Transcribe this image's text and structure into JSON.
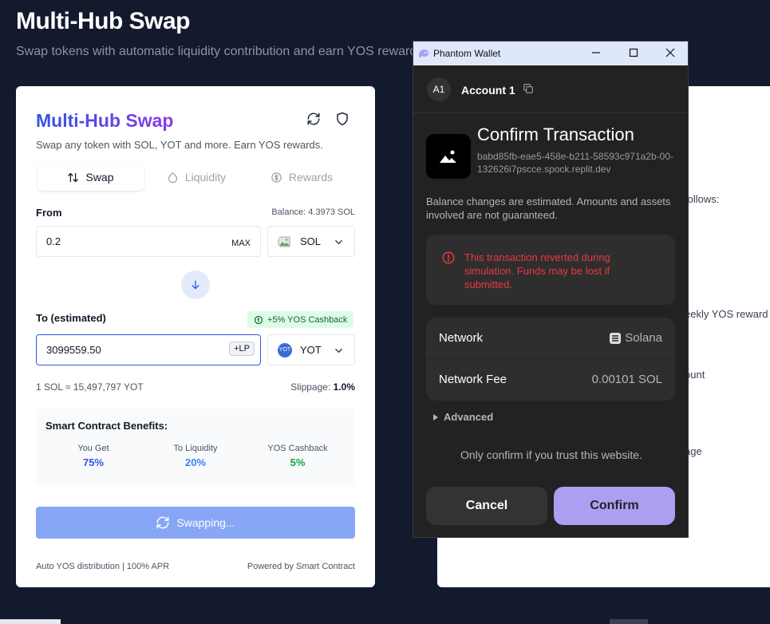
{
  "page": {
    "title": "Multi-Hub Swap",
    "subtitle": "Swap tokens with automatic liquidity contribution and earn YOS rewards"
  },
  "card": {
    "title": "Multi-Hub Swap",
    "description": "Swap any token with SOL, YOT and more. Earn YOS rewards.",
    "tabs": [
      {
        "label": "Swap",
        "icon": "swap-arrows-icon",
        "active": true
      },
      {
        "label": "Liquidity",
        "icon": "droplet-icon",
        "active": false
      },
      {
        "label": "Rewards",
        "icon": "coin-icon",
        "active": false
      }
    ],
    "from": {
      "label": "From",
      "balance": "Balance: 4.3973 SOL",
      "amount": "0.2",
      "max_label": "MAX",
      "token": "SOL"
    },
    "to": {
      "label": "To (estimated)",
      "cashback": "+5% YOS Cashback",
      "amount": "3099559.50",
      "lp_badge": "+LP",
      "token": "YOT",
      "token_icon_text": "YOT"
    },
    "rate": "1 SOL ≈ 15,497,797 YOT",
    "slippage_label": "Slippage:",
    "slippage_value": "1.0%",
    "benefits": {
      "title": "Smart Contract Benefits:",
      "items": [
        {
          "label": "You Get",
          "value": "75%",
          "color": "#2f56e6"
        },
        {
          "label": "To Liquidity",
          "value": "20%",
          "color": "#3b82f6"
        },
        {
          "label": "YOS Cashback",
          "value": "5%",
          "color": "#16a34a"
        }
      ]
    },
    "swap_button": "Swapping...",
    "footer_left": "Auto YOS distribution | 100% APR",
    "footer_right": "Powered by Smart Contract"
  },
  "background_panel": {
    "fragments": [
      "follows:",
      "eekly YOS reward",
      "ount",
      "age"
    ]
  },
  "wallet": {
    "window_title": "Phantom Wallet",
    "account_avatar": "A1",
    "account_name": "Account 1",
    "heading": "Confirm Transaction",
    "origin": "babd85fb-eae5-458e-b211-58593c971a2b-00-132626i7pscce.spock.replit.dev",
    "notice": "Balance changes are estimated. Amounts and assets involved are not guaranteed.",
    "warning": "This transaction reverted during simulation. Funds may be lost if submitted.",
    "network_label": "Network",
    "network_value": "Solana",
    "fee_label": "Network Fee",
    "fee_value": "0.00101 SOL",
    "advanced": "Advanced",
    "trust_text": "Only confirm if you trust this website.",
    "cancel": "Cancel",
    "confirm": "Confirm"
  },
  "colors": {
    "page_bg": "#131a2e",
    "accent_blue": "#2f56e6",
    "phantom_purple": "#ab9ff2",
    "error_red": "#eb3742"
  }
}
